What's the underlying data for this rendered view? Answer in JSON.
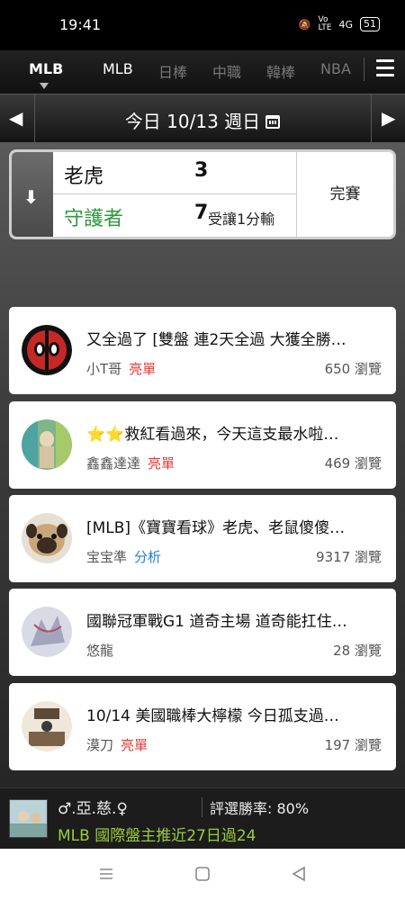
{
  "status_bar": {
    "time": "19:41",
    "network": "4G",
    "battery": "51"
  },
  "league_tabs": {
    "active": "MLB",
    "items": [
      "MLB",
      "日棒",
      "中職",
      "韓棒",
      "NBA"
    ]
  },
  "date_bar": {
    "date_text": "今日 10/13 週日"
  },
  "score_card": {
    "home_team": "老虎",
    "home_score": "3",
    "away_team": "守護者",
    "away_score": "7",
    "away_note": "受讓1分輸",
    "status": "完賽"
  },
  "posts": [
    {
      "title": "又全過了 [雙盤 連2天全過 大獲全勝…",
      "author": "小T哥",
      "tag": "亮單",
      "tag_color": "#e53935",
      "views": "650 瀏覽"
    },
    {
      "title": "⭐⭐救紅看過來，今天這支最水啦…",
      "author": "鑫鑫達達",
      "tag": "亮單",
      "tag_color": "#e53935",
      "views": "469 瀏覽"
    },
    {
      "title": "[MLB]《寶寶看球》老虎、老鼠傻傻…",
      "author": "宝宝準",
      "tag": "分析",
      "tag_color": "#1e7fd8",
      "views": "9317 瀏覽"
    },
    {
      "title": "國聯冠軍戰G1 道奇主場 道奇能扛住…",
      "author": "悠龍",
      "tag": "",
      "tag_color": "",
      "views": "28 瀏覽"
    },
    {
      "title": "10/14 美國職棒大檸檬 今日孤支過…",
      "author": "漠刀",
      "tag": "亮單",
      "tag_color": "#e53935",
      "views": "197 瀏覽"
    }
  ],
  "banner": {
    "user_name": "♂.亞.慈.♀",
    "win_rate": "評選勝率: 80%",
    "record": "MLB 國際盤主推近27日過24"
  }
}
